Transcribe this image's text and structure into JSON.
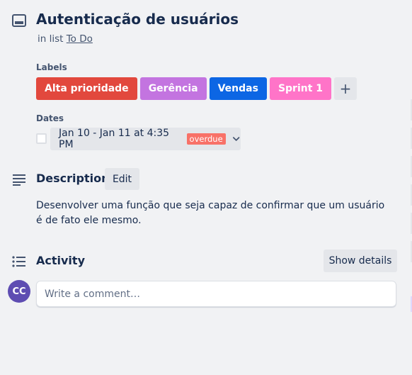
{
  "card": {
    "title": "Autenticação de usuários",
    "in_list_prefix": "in list",
    "list_name": "To Do"
  },
  "labels": {
    "heading": "Labels",
    "items": [
      {
        "text": "Alta prioridade",
        "color": "#e2483d"
      },
      {
        "text": "Gerência",
        "color": "#c374e0"
      },
      {
        "text": "Vendas",
        "color": "#0c66e4"
      },
      {
        "text": "Sprint 1",
        "color": "#ff74c8"
      }
    ],
    "add_symbol": "+"
  },
  "dates": {
    "heading": "Dates",
    "range": "Jan 10 - Jan 11 at 4:35 PM",
    "status": "overdue"
  },
  "description": {
    "heading": "Description",
    "edit_label": "Edit",
    "text": "Desenvolver uma função que seja capaz de confirmar que um usuário é de fato ele mesmo."
  },
  "activity": {
    "heading": "Activity",
    "show_details_label": "Show details",
    "avatar_initials": "CC",
    "comment_placeholder": "Write a comment…"
  }
}
